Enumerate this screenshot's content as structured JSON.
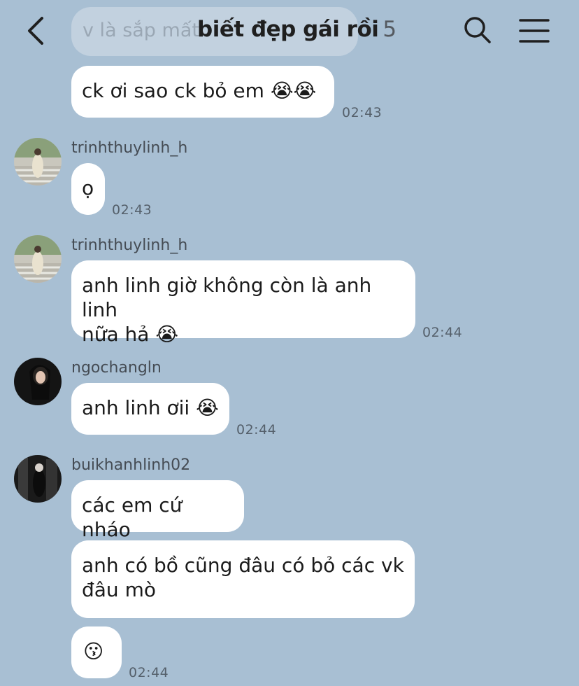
{
  "header": {
    "back_icon": "chevron-left-icon",
    "title": "biết đẹp gái rồi",
    "member_count": "5",
    "search_icon": "search-icon",
    "menu_icon": "menu-icon"
  },
  "faded_preview": "v là sắp mất",
  "messages": [
    {
      "text": "ck ơi sao ck bỏ em",
      "emojis": "😭😭",
      "time": "02:43"
    },
    {
      "sender": "trinhthuylinh_h",
      "text": "ọ",
      "time": "02:43"
    },
    {
      "sender": "trinhthuylinh_h",
      "line1": "anh linh giờ không còn là anh linh",
      "line2": "nữa hả",
      "emojis": "😭",
      "time": "02:44"
    },
    {
      "sender": "ngochangln",
      "text": "anh linh ơii",
      "emojis": "😭",
      "time": "02:44"
    },
    {
      "sender": "buikhanhlinh02",
      "text": "các em cứ nháo"
    },
    {
      "line1": "anh có bồ cũng đâu có bỏ các vk",
      "line2": "đâu mò"
    },
    {
      "emojis": "😗",
      "time": "02:44"
    }
  ],
  "colors": {
    "background": "#a8bfd3",
    "bubble": "#ffffff",
    "text": "#1b1b1b",
    "timestamp": "#55606b"
  }
}
